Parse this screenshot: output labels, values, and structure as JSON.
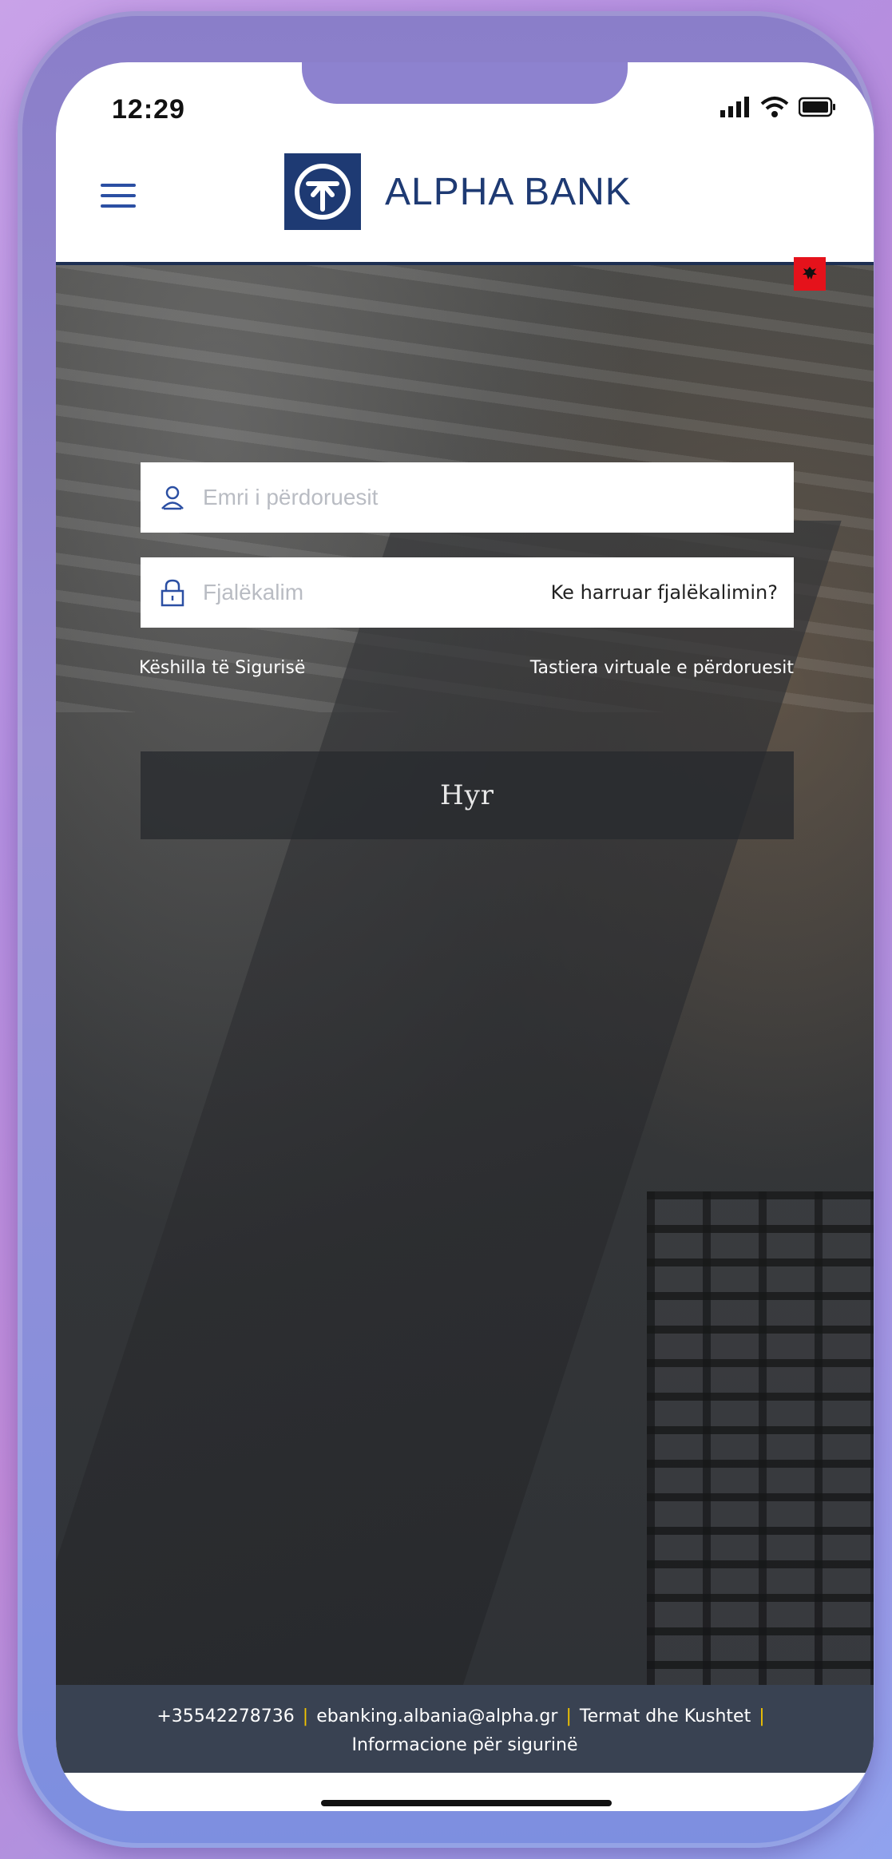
{
  "status_bar": {
    "time": "12:29"
  },
  "header": {
    "brand_name": "ALPHA BANK",
    "brand_color": "#1e3a73",
    "flag_color": "#e5121b",
    "icons": [
      "menu-icon",
      "alpha-bank-logo",
      "albania-flag-icon"
    ]
  },
  "login": {
    "username_placeholder": "Emri i përdoruesit",
    "password_placeholder": "Fjalëkalim",
    "forgot_password": "Ke harruar fjalëkalimin?",
    "security_tips": "Këshilla të Sigurisë",
    "virtual_keyboard": "Tastiera virtuale e përdoruesit",
    "submit_label": "Hyr"
  },
  "footer": {
    "phone": "+35542278736",
    "email": "ebanking.albania@alpha.gr",
    "terms": "Termat dhe Kushtet",
    "security_info": "Informacione për sigurinë",
    "separator": "|",
    "separator_color": "#f2c400"
  }
}
